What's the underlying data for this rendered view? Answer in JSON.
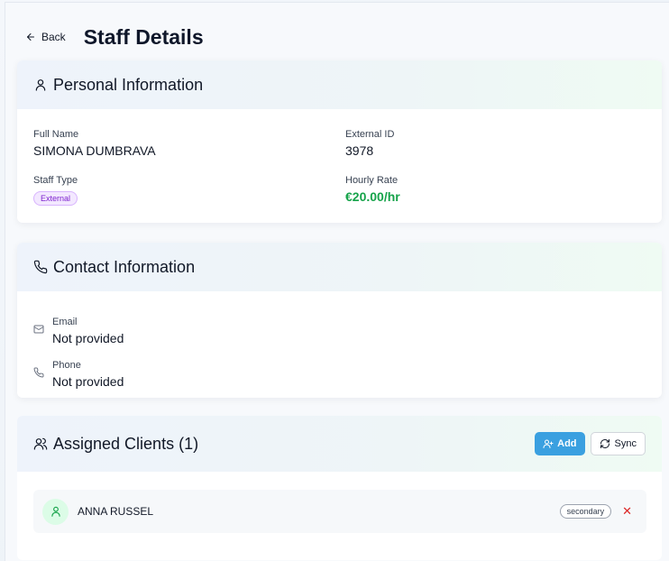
{
  "header": {
    "back_label": "Back",
    "title": "Staff Details"
  },
  "personal": {
    "title": "Personal Information",
    "full_name_label": "Full Name",
    "full_name": "SIMONA DUMBRAVA",
    "external_id_label": "External ID",
    "external_id": "3978",
    "staff_type_label": "Staff Type",
    "staff_type": "External",
    "hourly_rate_label": "Hourly Rate",
    "hourly_rate": "€20.00/hr"
  },
  "contact": {
    "title": "Contact Information",
    "email_label": "Email",
    "email_value": "Not provided",
    "phone_label": "Phone",
    "phone_value": "Not provided"
  },
  "clients": {
    "title": "Assigned Clients (1)",
    "add_label": "Add",
    "sync_label": "Sync",
    "items": [
      {
        "name": "ANNA RUSSEL",
        "role": "secondary",
        "remove": "✕"
      }
    ]
  },
  "colors": {
    "accent": "#3aa0e0",
    "rate_green": "#16a34a",
    "remove_red": "#dc2626",
    "badge_purple": "#7e22ce"
  },
  "icons": {
    "back": "arrow-left-icon",
    "personal": "user-icon",
    "contact": "phone-icon",
    "email": "mail-icon",
    "phone": "phone-icon",
    "clients": "users-icon",
    "add": "user-plus-icon",
    "sync": "refresh-icon",
    "avatar": "user-icon"
  }
}
